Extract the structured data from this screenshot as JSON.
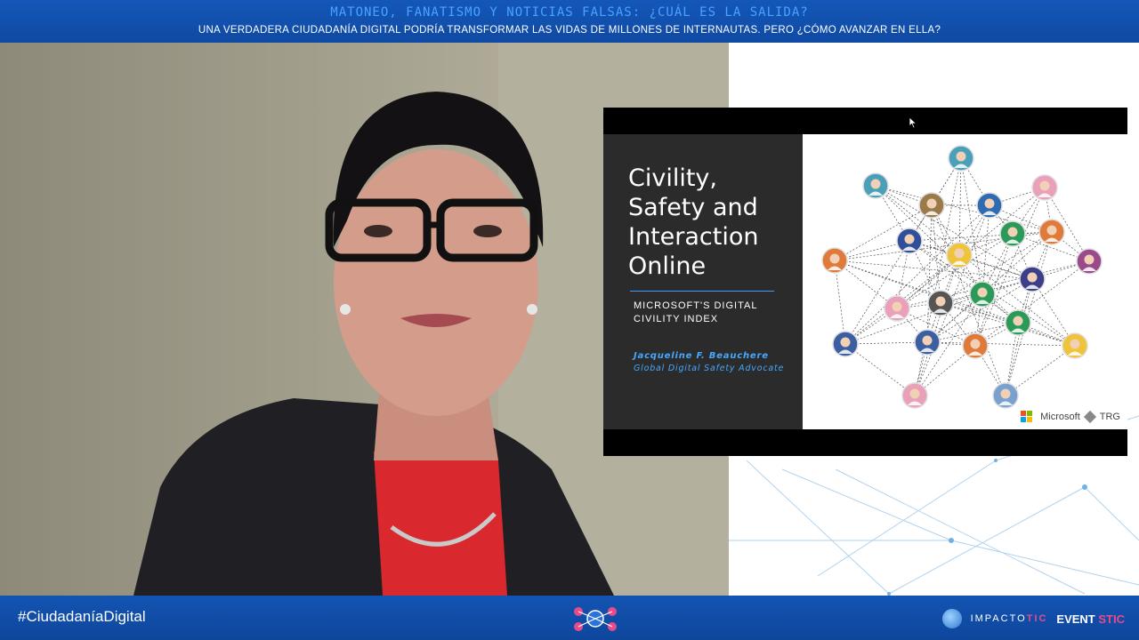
{
  "banner": {
    "title": "Matoneo, fanatismo y noticias falsas: ¿cuál es la salida?",
    "subtitle": "UNA VERDADERA CIUDADANÍA DIGITAL PODRÍA TRANSFORMAR LAS VIDAS DE MILLONES DE INTERNAUTAS. PERO ¿CÓMO AVANZAR EN ELLA?"
  },
  "slide": {
    "title": "Civility, Safety and Interaction Online",
    "subtitle": "MICROSOFT'S DIGITAL CIVILITY INDEX",
    "author": "Jacqueline F. Beauchere",
    "role": "Global Digital Safety Advocate",
    "logo_microsoft": "Microsoft",
    "logo_trg": "TRG"
  },
  "footer": {
    "hashtag": "#CiudadaníaDigital",
    "brand_impacto_a": "IMPACTO",
    "brand_impacto_b": "TIC",
    "brand_events_a": "EVENT",
    "brand_events_b": "STIC"
  },
  "icons": [
    "network-avatar-icon",
    "microsoft-logo-icon",
    "trg-logo-icon",
    "cursor-icon",
    "event-logo-icon"
  ],
  "colors": {
    "banner_blue": "#1457b8",
    "banner_title": "#4aa3ff",
    "slide_accent": "#3aa0ff",
    "brand_pink": "#e94b8a"
  }
}
